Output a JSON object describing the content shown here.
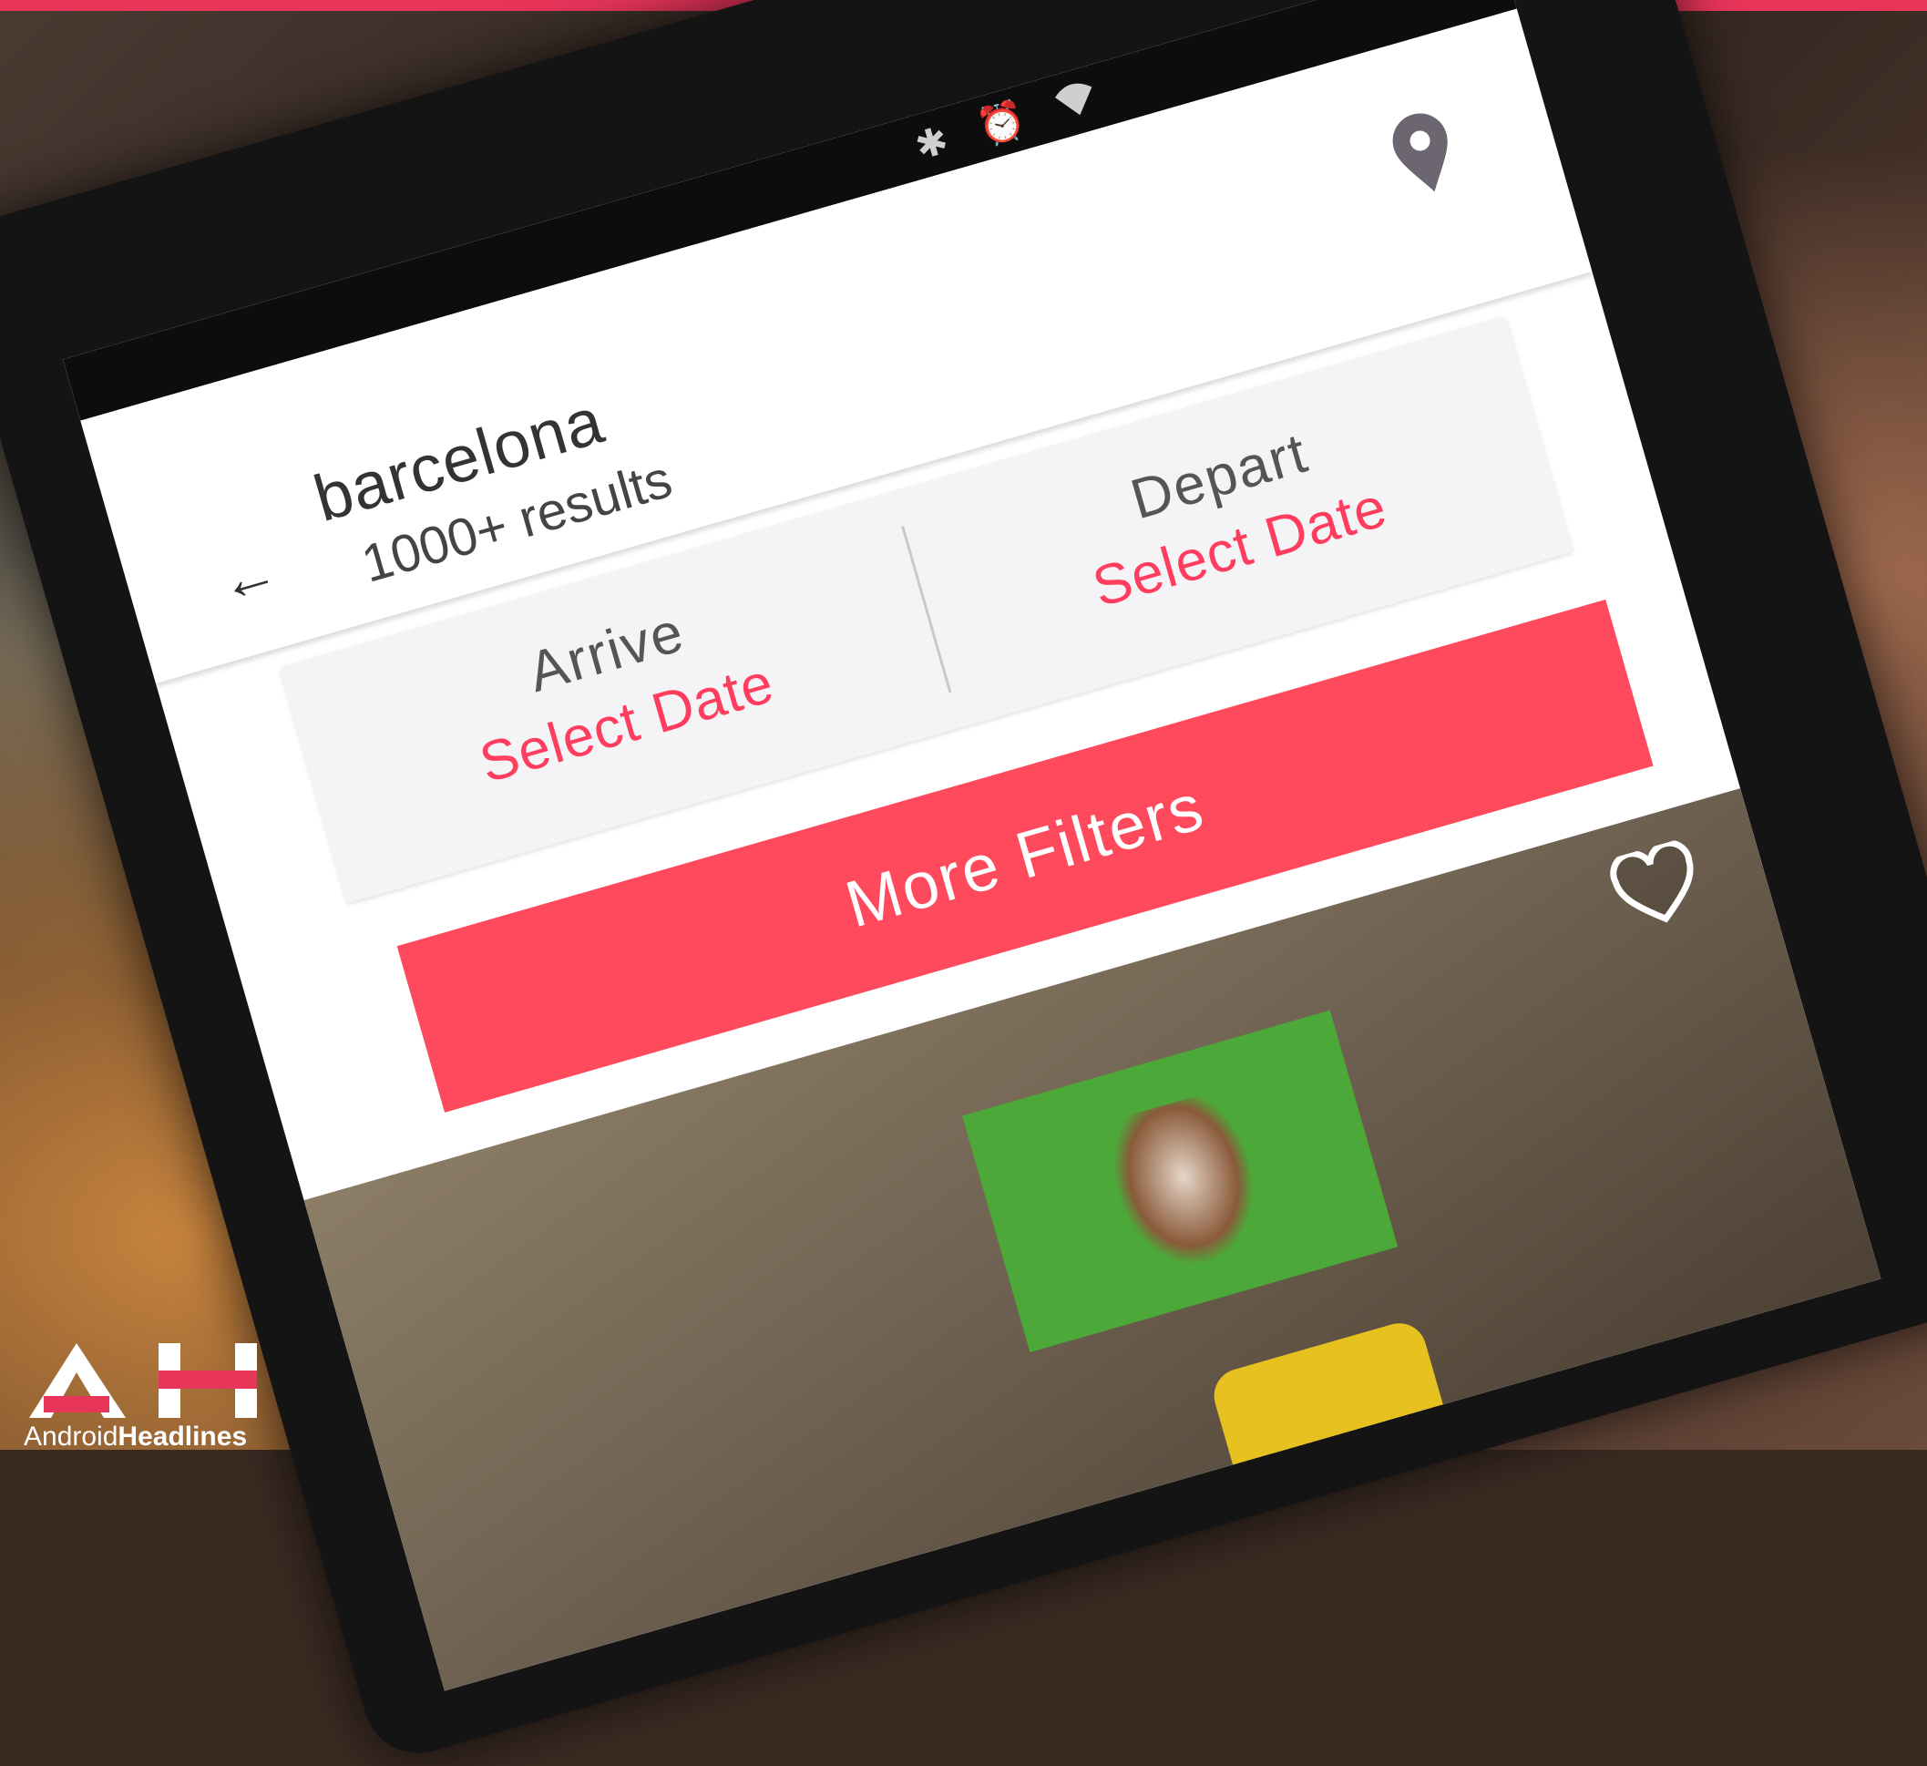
{
  "status_bar": {
    "icons": [
      "bluetooth-icon",
      "alarm-icon",
      "wifi-icon"
    ]
  },
  "search": {
    "title": "barcelona",
    "result_count": "1000+ results"
  },
  "dates": {
    "arrive_label": "Arrive",
    "arrive_value": "Select Date",
    "depart_label": "Depart",
    "depart_value": "Select Date"
  },
  "filters_button": {
    "label": "More Filters"
  },
  "watermark": {
    "logo_letters": "AH",
    "brand_light": "Android",
    "brand_bold": "Headlines"
  },
  "colors": {
    "accent": "#ff4a5d",
    "date_value": "#ff3e5f",
    "top_stripe": "#e8355a"
  }
}
